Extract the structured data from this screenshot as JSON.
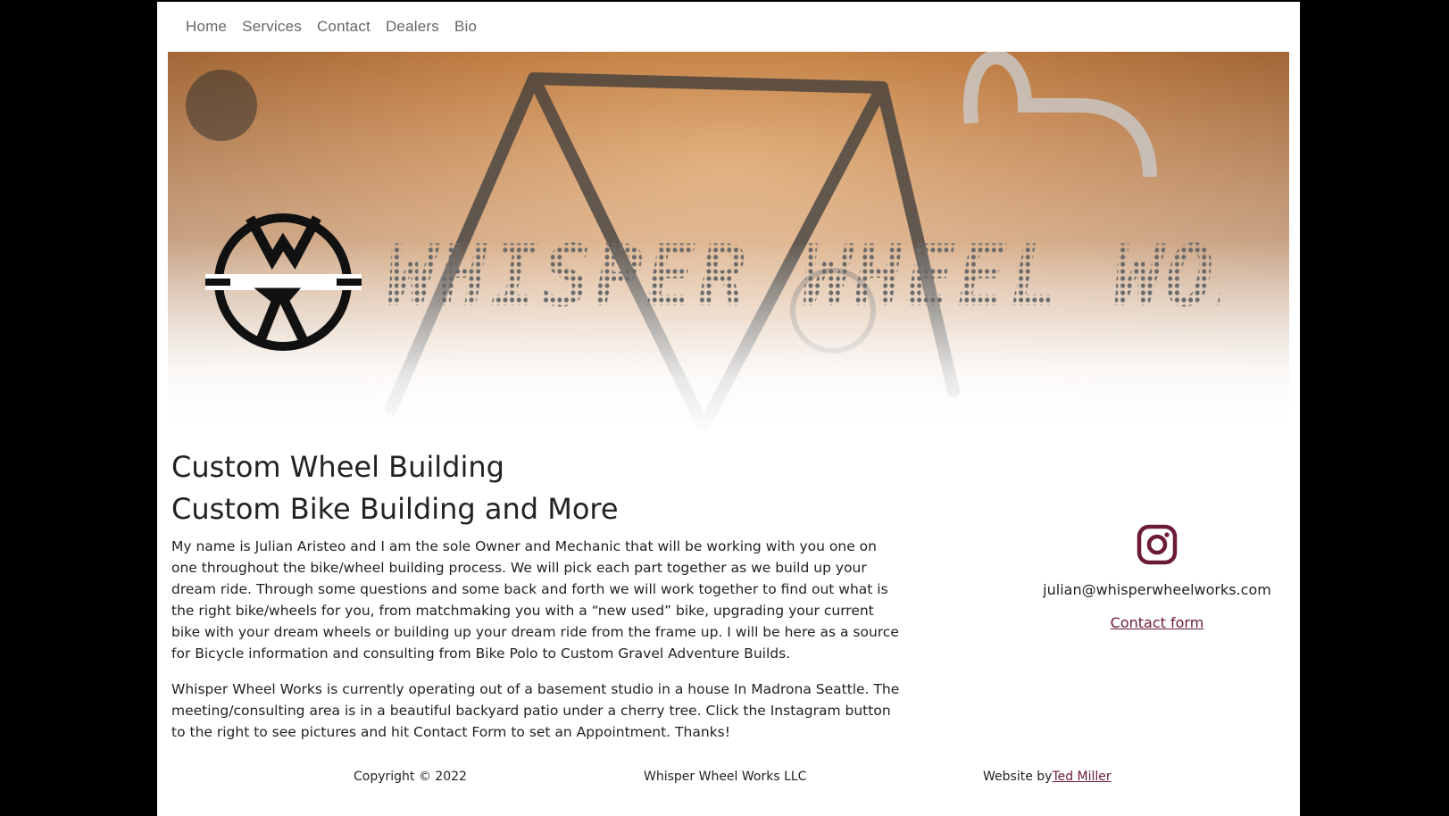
{
  "nav": {
    "items": [
      "Home",
      "Services",
      "Contact",
      "Dealers",
      "Bio"
    ]
  },
  "hero": {
    "wordmark": "WHISPER WHEEL WORKS",
    "logo_icon": "ww-bolt-logo-icon"
  },
  "headings": {
    "title1": "Custom Wheel Building",
    "title2": "Custom Bike Building and More"
  },
  "body": {
    "p1": "My name is Julian Aristeo and I am the sole Owner and Mechanic that will be working with you one on one throughout the bike/wheel building process. We will pick each part together as we build up your dream ride. Through some questions and some back and forth we will work together to find out what is the right bike/wheels for you, from matchmaking you with a “new used” bike, upgrading your current bike with your dream wheels or building up your dream ride from the frame up. I will be here as a source for Bicycle information and consulting from Bike Polo to Custom Gravel Adventure Builds.",
    "p2": "Whisper Wheel Works is currently operating out of a basement studio in a house In Madrona Seattle. The meeting/consulting area is in a beautiful backyard patio under a cherry tree. Click the Instagram button to the right to see pictures and hit Contact Form to set an Appointment. Thanks!"
  },
  "sidebar": {
    "instagram_icon": "instagram-icon",
    "email": "julian@whisperwheelworks.com",
    "contact_link": "Contact form",
    "accent_color": "#6b1a3a"
  },
  "footer": {
    "copyright": "Copyright © 2022",
    "company": "Whisper Wheel Works LLC",
    "credit_prefix": "Website by",
    "credit_link": "Ted Miller"
  }
}
